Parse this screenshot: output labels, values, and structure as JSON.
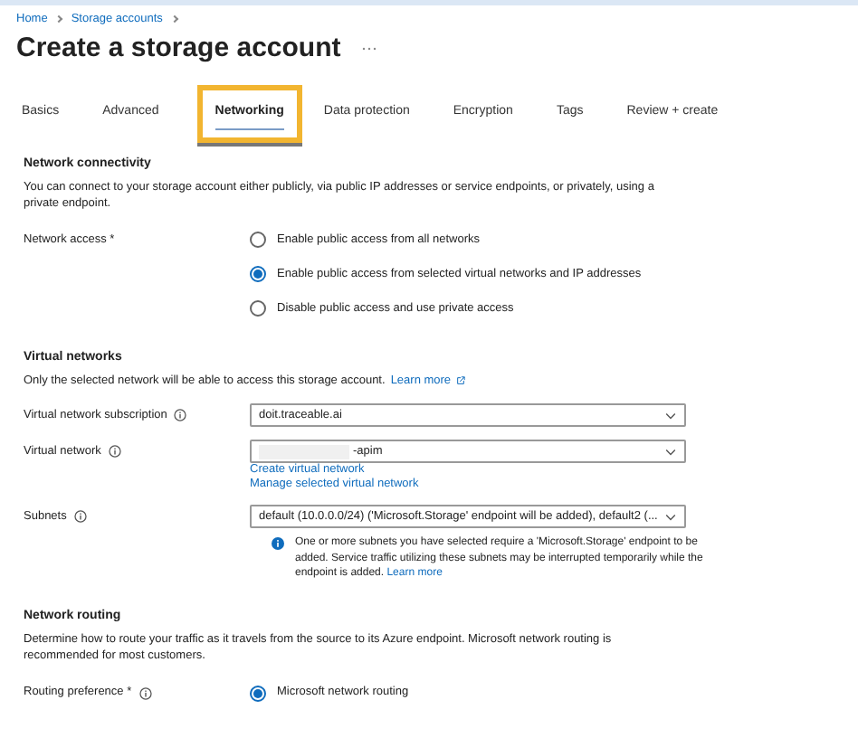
{
  "breadcrumb": [
    "Home",
    "Storage accounts"
  ],
  "title": "Create a storage account",
  "tabs": [
    {
      "label": "Basics",
      "selected": false,
      "highlighted": false
    },
    {
      "label": "Advanced",
      "selected": false,
      "highlighted": false
    },
    {
      "label": "Networking",
      "selected": true,
      "highlighted": true
    },
    {
      "label": "Data protection",
      "selected": false,
      "highlighted": false
    },
    {
      "label": "Encryption",
      "selected": false,
      "highlighted": false
    },
    {
      "label": "Tags",
      "selected": false,
      "highlighted": false
    },
    {
      "label": "Review + create",
      "selected": false,
      "highlighted": false
    }
  ],
  "network_connectivity": {
    "heading": "Network connectivity",
    "description": "You can connect to your storage account either publicly, via public IP addresses or service endpoints, or privately, using a private endpoint.",
    "label": "Network access *",
    "options": [
      {
        "label": "Enable public access from all networks",
        "selected": false
      },
      {
        "label": "Enable public access from selected virtual networks and IP addresses",
        "selected": true
      },
      {
        "label": "Disable public access and use private access",
        "selected": false
      }
    ]
  },
  "virtual_networks": {
    "heading": "Virtual networks",
    "description": "Only the selected network will be able to access this storage account.",
    "learn_more": "Learn more",
    "fields": [
      {
        "label": "Virtual network subscription",
        "info": true,
        "value": "doit.traceable.ai"
      },
      {
        "label": "Virtual network",
        "info": true,
        "value": "-apim",
        "redacted": true,
        "links": [
          "Create virtual network",
          "Manage selected virtual network"
        ]
      },
      {
        "label": "Subnets",
        "info": true,
        "value": "default (10.0.0.0/24) ('Microsoft.Storage' endpoint will be added), default2 (..."
      }
    ],
    "notice": {
      "text": "One or more subnets you have selected require a 'Microsoft.Storage' endpoint to be added. Service traffic utilizing these subnets may be interrupted temporarily while the endpoint is added.",
      "link": "Learn more"
    }
  },
  "network_routing": {
    "heading": "Network routing",
    "description": "Determine how to route your traffic as it travels from the source to its Azure endpoint. Microsoft network routing is recommended for most customers.",
    "label": "Routing preference *",
    "info": true,
    "options": [
      {
        "label": "Microsoft network routing",
        "selected": true
      }
    ]
  }
}
